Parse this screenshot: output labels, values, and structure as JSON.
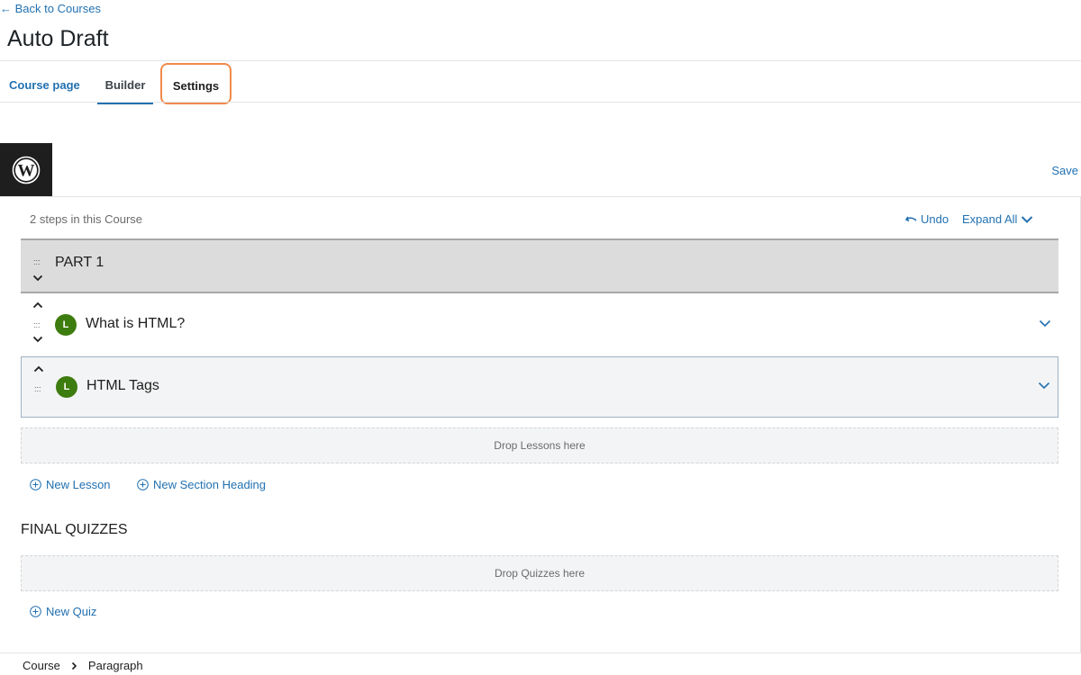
{
  "header": {
    "back_link": "← Back to Courses",
    "title": "Auto Draft"
  },
  "tabs": [
    {
      "label": "Course page",
      "active": false
    },
    {
      "label": "Builder",
      "active": true
    },
    {
      "label": "Settings",
      "active": false,
      "highlighted": true
    }
  ],
  "toolbar": {
    "save_label": "Save"
  },
  "builder": {
    "steps_count": "2 steps in this Course",
    "undo_label": "Undo",
    "expand_all_label": "Expand All",
    "section": {
      "title": "PART 1"
    },
    "lessons": [
      {
        "badge": "L",
        "title": "What is HTML?"
      },
      {
        "badge": "L",
        "title": "HTML Tags"
      }
    ],
    "drop_lessons_label": "Drop Lessons here",
    "new_lesson_label": "New Lesson",
    "new_section_label": "New Section Heading",
    "quizzes_heading": "FINAL QUIZZES",
    "drop_quizzes_label": "Drop Quizzes here",
    "new_quiz_label": "New Quiz"
  },
  "breadcrumbs": [
    "Course",
    "Paragraph"
  ],
  "colors": {
    "accent": "#2271b1",
    "lesson_badge": "#3d7c0e",
    "highlight_outline": "#f08a4b",
    "section_bg": "#dcdcdc"
  }
}
